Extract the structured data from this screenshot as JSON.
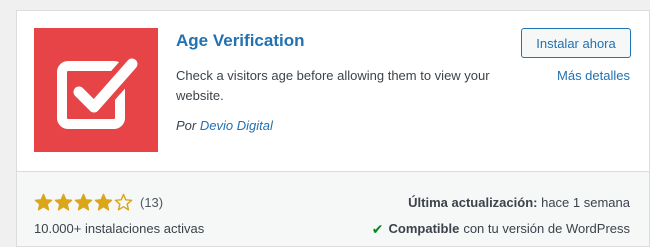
{
  "plugin": {
    "title": "Age Verification",
    "description": "Check a visitors age before allowing them to view your website.",
    "author_prefix": "Por",
    "author_name": "Devio Digital",
    "icon": "checkbox-check-icon",
    "icon_bg_color": "#e64447"
  },
  "actions": {
    "install_label": "Instalar ahora",
    "details_label": "Más detalles"
  },
  "footer": {
    "rating_stars": 4,
    "rating_max": 5,
    "rating_count": "(13)",
    "installs": "10.000+ instalaciones activas",
    "updated_label": "Última actualización:",
    "updated_value": "hace 1 semana",
    "compat_strong": "Compatible",
    "compat_rest": "con tu versión de WordPress",
    "compat_icon": "checkmark-icon"
  },
  "colors": {
    "accent": "#2271b1",
    "star": "#dba617",
    "success": "#008a20"
  }
}
